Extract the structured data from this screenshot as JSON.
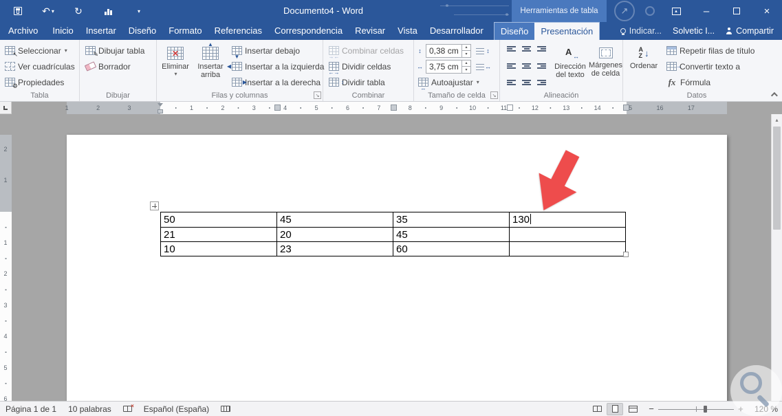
{
  "colors": {
    "titlebar": "#2b579a",
    "contextual": "#4a79be",
    "ribbon_bg": "#f5f6f9",
    "doc_bg": "#a6a6a6",
    "arrow": "#ee4c4c",
    "accent": "#2b579a"
  },
  "icons": {
    "undo": "↶",
    "redo": "↻",
    "caret_down": "▾",
    "caret_up": "▴",
    "spin_up": "▴",
    "spin_down": "▾",
    "close": "×",
    "minimize": "–",
    "arrow_up": "▲",
    "arrow_down": "▼",
    "arrow_left": "◀",
    "arrow_right": "▶",
    "red_cross": "×",
    "pencil": "✎",
    "gear": "⚙",
    "select_arrow": "↖",
    "split": "←→",
    "merge": "→←",
    "updown": "↕",
    "leftright": "↔",
    "to_arrow": "→",
    "formula": "fx",
    "letter_a": "A",
    "letter_z": "Z",
    "sort_down": "↓",
    "launcher": "↘",
    "scroll_up": "▴",
    "ne_arrow": "↗",
    "plus": "+",
    "minus": "−"
  },
  "titlebar": {
    "title": "Documento4 - Word",
    "contextual_header": "Herramientas de tabla"
  },
  "tabs": {
    "file": "Archivo",
    "main": [
      "Inicio",
      "Insertar",
      "Diseño",
      "Formato",
      "Referencias",
      "Correspondencia",
      "Revisar",
      "Vista",
      "Desarrollador"
    ],
    "contextual": [
      "Diseño",
      "Presentación"
    ],
    "active": "Presentación",
    "tell_me": "Indicar...",
    "account": "Solvetic I...",
    "share": "Compartir"
  },
  "ribbon": {
    "tabla": {
      "label": "Tabla",
      "seleccionar": "Seleccionar",
      "cuadriculas": "Ver cuadrículas",
      "propiedades": "Propiedades"
    },
    "dibujar": {
      "label": "Dibujar",
      "dibujar_tabla": "Dibujar tabla",
      "borrador": "Borrador"
    },
    "filas": {
      "label": "Filas y columnas",
      "eliminar": "Eliminar",
      "insertar_arriba": "Insertar arriba",
      "insertar_debajo": "Insertar debajo",
      "insertar_izquierda": "Insertar a la izquierda",
      "insertar_derecha": "Insertar a la derecha"
    },
    "combinar": {
      "label": "Combinar",
      "combinar_celdas": "Combinar celdas",
      "dividir_celdas": "Dividir celdas",
      "dividir_tabla": "Dividir tabla"
    },
    "tamano": {
      "label": "Tamaño de celda",
      "alto": "0,38 cm",
      "ancho": "3,75 cm",
      "autoajustar": "Autoajustar"
    },
    "alineacion": {
      "label": "Alineación",
      "direccion": "Dirección del texto",
      "margenes": "Márgenes de celda"
    },
    "datos": {
      "label": "Datos",
      "ordenar": "Ordenar",
      "repetir": "Repetir filas de título",
      "convertir": "Convertir texto a",
      "formula": "Fórmula"
    }
  },
  "ruler": {
    "h_left": [
      "3",
      "2",
      "1"
    ],
    "h_right": [
      "1",
      "2",
      "3",
      "4",
      "5",
      "6",
      "7",
      "8",
      "9",
      "10",
      "11",
      "12",
      "13",
      "14",
      "15",
      "16",
      "17"
    ],
    "v_top": [
      "2",
      "1"
    ],
    "v_bottom": [
      "1",
      "2",
      "3",
      "4",
      "5",
      "6"
    ]
  },
  "doc": {
    "table": {
      "rows": [
        [
          "50",
          "45",
          "35",
          "130"
        ],
        [
          "21",
          "20",
          "45",
          ""
        ],
        [
          "10",
          "23",
          "60",
          ""
        ]
      ]
    }
  },
  "statusbar": {
    "page": "Página 1 de 1",
    "words": "10 palabras",
    "language": "Español (España)",
    "zoom": "120 %"
  }
}
